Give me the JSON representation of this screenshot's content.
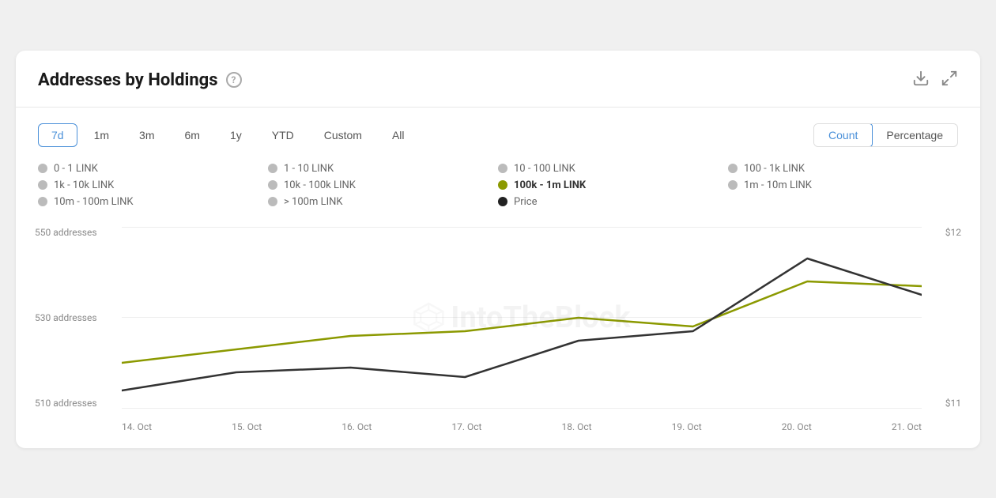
{
  "header": {
    "title": "Addresses by Holdings",
    "help_tooltip": "?",
    "download_icon": "⬇",
    "expand_icon": "✕"
  },
  "time_buttons": [
    {
      "label": "7d",
      "active": true
    },
    {
      "label": "1m",
      "active": false
    },
    {
      "label": "3m",
      "active": false
    },
    {
      "label": "6m",
      "active": false
    },
    {
      "label": "1y",
      "active": false
    },
    {
      "label": "YTD",
      "active": false
    },
    {
      "label": "Custom",
      "active": false
    },
    {
      "label": "All",
      "active": false
    }
  ],
  "view_buttons": [
    {
      "label": "Count",
      "active": true
    },
    {
      "label": "Percentage",
      "active": false
    }
  ],
  "legend": [
    {
      "label": "0 - 1 LINK",
      "color": "#bbb",
      "bold": false
    },
    {
      "label": "1 - 10 LINK",
      "color": "#bbb",
      "bold": false
    },
    {
      "label": "10 - 100 LINK",
      "color": "#bbb",
      "bold": false
    },
    {
      "label": "100 - 1k LINK",
      "color": "#bbb",
      "bold": false
    },
    {
      "label": "1k - 10k LINK",
      "color": "#bbb",
      "bold": false
    },
    {
      "label": "10k - 100k LINK",
      "color": "#bbb",
      "bold": false
    },
    {
      "label": "100k - 1m LINK",
      "color": "#8B9900",
      "bold": true
    },
    {
      "label": "1m - 10m LINK",
      "color": "#bbb",
      "bold": false
    },
    {
      "label": "10m - 100m LINK",
      "color": "#bbb",
      "bold": false
    },
    {
      "label": "> 100m LINK",
      "color": "#bbb",
      "bold": false
    },
    {
      "label": "Price",
      "color": "#222",
      "bold": false
    }
  ],
  "chart": {
    "y_left": {
      "top": "550 addresses",
      "mid": "530 addresses",
      "bottom": "510 addresses"
    },
    "y_right": {
      "top": "$12",
      "bottom": "$11"
    },
    "x_labels": [
      "14. Oct",
      "15. Oct",
      "16. Oct",
      "17. Oct",
      "18. Oct",
      "19. Oct",
      "20. Oct",
      "21. Oct"
    ],
    "watermark": "IntoTheBlock",
    "series_olive": [
      520,
      523,
      526,
      527,
      530,
      528,
      538,
      537
    ],
    "series_dark": [
      514,
      518,
      519,
      517,
      525,
      527,
      543,
      535
    ]
  }
}
